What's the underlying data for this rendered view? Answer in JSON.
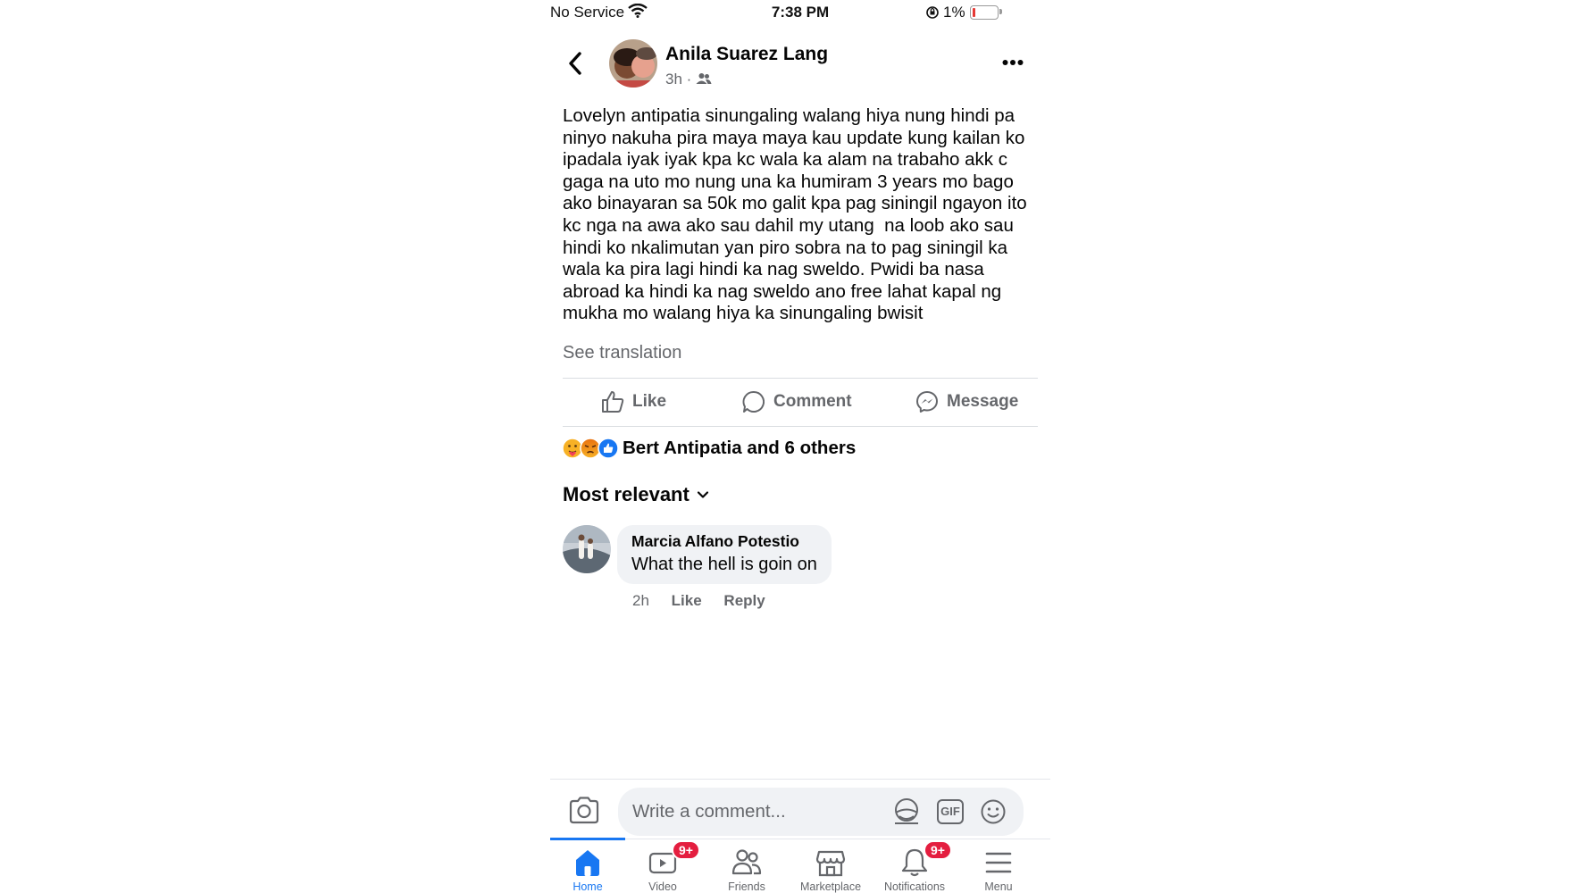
{
  "status_bar": {
    "carrier": "No Service",
    "time": "7:38 PM",
    "battery": "1%",
    "battery_level_percent": 1,
    "icons": [
      "wifi-icon",
      "orientation-lock-icon",
      "battery-icon"
    ]
  },
  "post": {
    "author": "Anila Suarez Lang",
    "time": "3h",
    "separator": "·",
    "audience_icon": "friends-audience-icon",
    "body": "Lovelyn antipatia sinungaling walang hiya nung hindi pa\nninyo nakuha pira maya maya kau update kung kailan ko\nipadala iyak iyak kpa kc wala ka alam na trabaho akk c\ngaga na uto mo nung una ka humiram 3 years mo bago\nako binayaran sa 50k mo galit kpa pag siningil ngayon ito\nkc nga na awa ako sau dahil my utang  na loob ako sau\nhindi ko nkalimutan yan piro sobra na to pag siningil ka\nwala ka pira lagi hindi ka nag sweldo. Pwidi ba nasa\nabroad ka hindi ka nag sweldo ano free lahat kapal ng\nmukha mo walang hiya ka sinungaling bwisit",
    "see_translation": "See translation"
  },
  "actions": {
    "like": "Like",
    "comment": "Comment",
    "message": "Message"
  },
  "reactions": {
    "summary": "Bert Antipatia and 6 others",
    "types": [
      "care",
      "angry",
      "like"
    ]
  },
  "comments_section": {
    "sort_label": "Most relevant",
    "comments": [
      {
        "author": "Marcia Alfano Potestio",
        "text": "What the hell is goin on",
        "time": "2h",
        "like": "Like",
        "reply": "Reply"
      }
    ]
  },
  "composer": {
    "placeholder": "Write a comment...",
    "gif_label": "GIF"
  },
  "bottom_nav": {
    "items": [
      {
        "label": "Home",
        "icon": "home-icon",
        "active": true
      },
      {
        "label": "Video",
        "icon": "video-icon",
        "badge": "9+"
      },
      {
        "label": "Friends",
        "icon": "friends-icon"
      },
      {
        "label": "Marketplace",
        "icon": "marketplace-icon"
      },
      {
        "label": "Notifications",
        "icon": "bell-icon",
        "badge": "9+"
      },
      {
        "label": "Menu",
        "icon": "menu-icon"
      }
    ]
  },
  "colors": {
    "accent": "#1877f2",
    "badge": "#e41e3f",
    "secondary_text": "#65676b",
    "bubble": "#f0f2f5"
  }
}
